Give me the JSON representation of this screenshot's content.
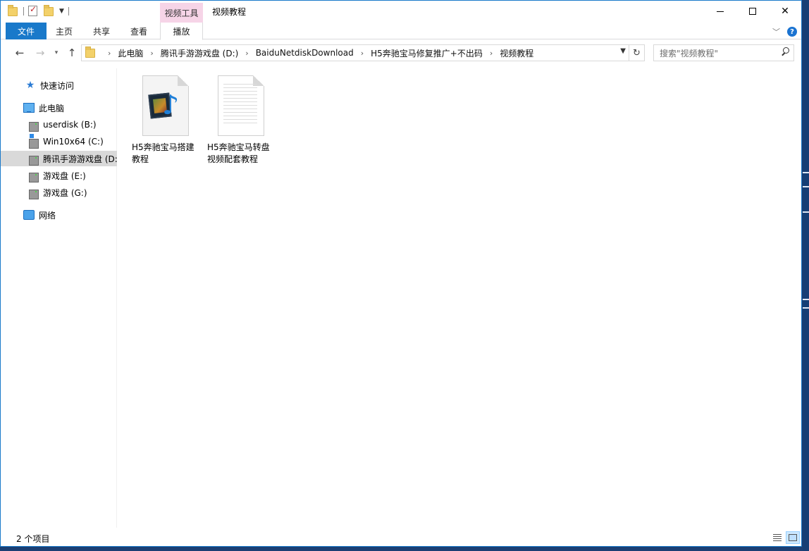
{
  "window": {
    "title": "视频教程",
    "context_tab": "视频工具"
  },
  "ribbon": {
    "tabs": [
      {
        "label": "文件"
      },
      {
        "label": "主页"
      },
      {
        "label": "共享"
      },
      {
        "label": "查看"
      },
      {
        "label": "播放"
      }
    ],
    "help": "?"
  },
  "nav": {
    "breadcrumbs": [
      "此电脑",
      "腾讯手游游戏盘 (D:)",
      "BaiduNetdiskDownload",
      "H5奔驰宝马修复推广+不出码",
      "视频教程"
    ],
    "search_placeholder": "搜索\"视频教程\""
  },
  "sidebar": {
    "items": [
      {
        "label": "快速访问",
        "icon": "star-icon"
      },
      {
        "label": "此电脑",
        "icon": "computer-icon"
      },
      {
        "label": "userdisk (B:)",
        "icon": "drive-icon"
      },
      {
        "label": "Win10x64 (C:)",
        "icon": "windows-drive-icon"
      },
      {
        "label": "腾讯手游游戏盘 (D:)",
        "icon": "drive-icon",
        "selected": true
      },
      {
        "label": "游戏盘 (E:)",
        "icon": "drive-icon"
      },
      {
        "label": "游戏盘 (G:)",
        "icon": "drive-icon"
      },
      {
        "label": "网络",
        "icon": "network-icon"
      }
    ]
  },
  "files": [
    {
      "name": "H5奔驰宝马搭建教程",
      "icon": "video-file-icon"
    },
    {
      "name": "H5奔驰宝马转盘视频配套教程",
      "icon": "text-file-icon"
    }
  ],
  "status": {
    "count": "2 个项目"
  }
}
